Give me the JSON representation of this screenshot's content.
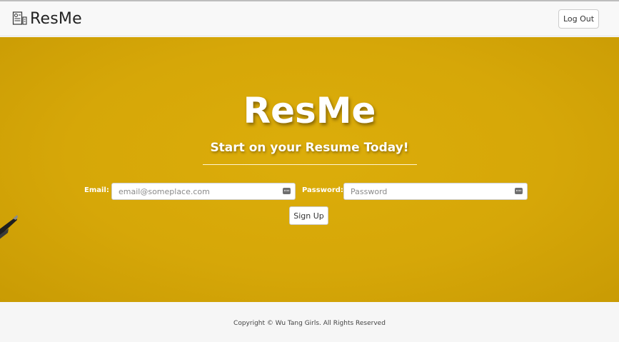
{
  "navbar": {
    "brand": "ResMe",
    "logout_label": "Log Out"
  },
  "hero": {
    "title": "ResMe",
    "subtitle": "Start on your Resume Today!"
  },
  "signup_form": {
    "email_label": "Email:",
    "email_placeholder": "email@someplace.com",
    "password_label": "Password:",
    "password_placeholder": "Password",
    "submit_label": "Sign Up"
  },
  "footer": {
    "copyright": "Copyright © Wu Tang Girls. All Rights Reserved"
  },
  "icons": {
    "brand": "resume-document-icon",
    "field_autofill": "keyboard-icon"
  },
  "colors": {
    "hero_background": "#d6a708",
    "navbar_background": "#f8f8f8",
    "footer_background": "#f6f6f6"
  }
}
